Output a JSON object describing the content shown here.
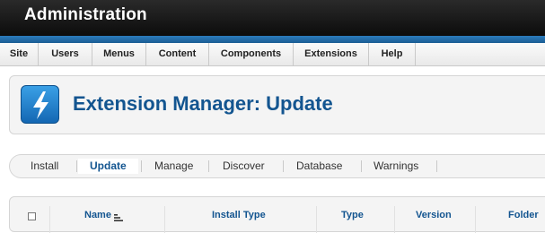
{
  "header": {
    "title": "Administration"
  },
  "menu": {
    "items": [
      {
        "label": "Site"
      },
      {
        "label": "Users"
      },
      {
        "label": "Menus"
      },
      {
        "label": "Content"
      },
      {
        "label": "Components"
      },
      {
        "label": "Extensions"
      },
      {
        "label": "Help"
      }
    ]
  },
  "toolbar": {
    "title": "Extension Manager: Update",
    "icon": "lightning-icon"
  },
  "subnav": {
    "tabs": [
      {
        "label": "Install",
        "active": false
      },
      {
        "label": "Update",
        "active": true
      },
      {
        "label": "Manage",
        "active": false
      },
      {
        "label": "Discover",
        "active": false
      },
      {
        "label": "Database",
        "active": false
      },
      {
        "label": "Warnings",
        "active": false
      }
    ]
  },
  "table": {
    "columns": [
      "Name",
      "Install Type",
      "Type",
      "Version",
      "Folder"
    ]
  },
  "colors": {
    "header_bg": "#111111",
    "accent_blue": "#1b5d93",
    "title_blue": "#135590"
  }
}
